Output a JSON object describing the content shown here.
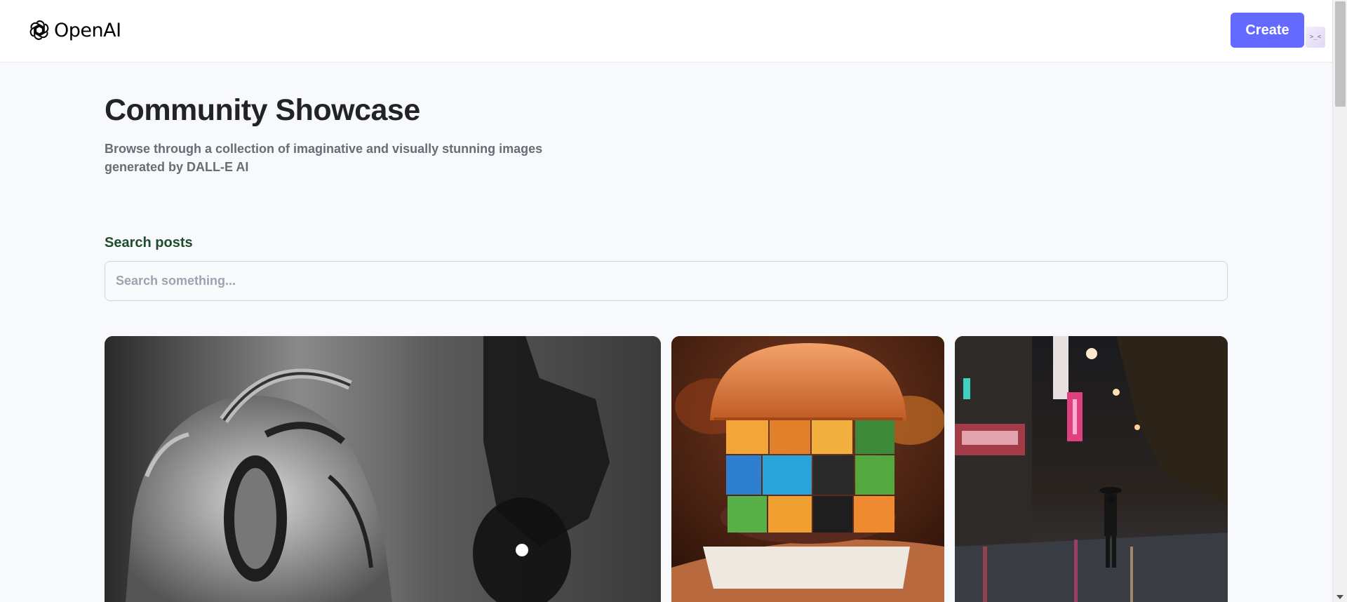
{
  "header": {
    "brand_name": "OpenAI",
    "create_label": "Create",
    "extension_glyph": ">_<"
  },
  "main": {
    "title": "Community Showcase",
    "description": "Browse through a collection of imaginative and visually stunning images generated by DALL-E AI"
  },
  "search": {
    "label": "Search posts",
    "placeholder": "Search something...",
    "value": ""
  },
  "posts": [
    {
      "image": "statue-with-headphones"
    },
    {
      "image": "rubiks-cube-burger"
    },
    {
      "image": "rainy-night-street"
    }
  ],
  "colors": {
    "accent": "#6469ff",
    "page_background": "#f8f9fc",
    "label_green": "#1f4d2c",
    "muted_text": "#666e75"
  }
}
